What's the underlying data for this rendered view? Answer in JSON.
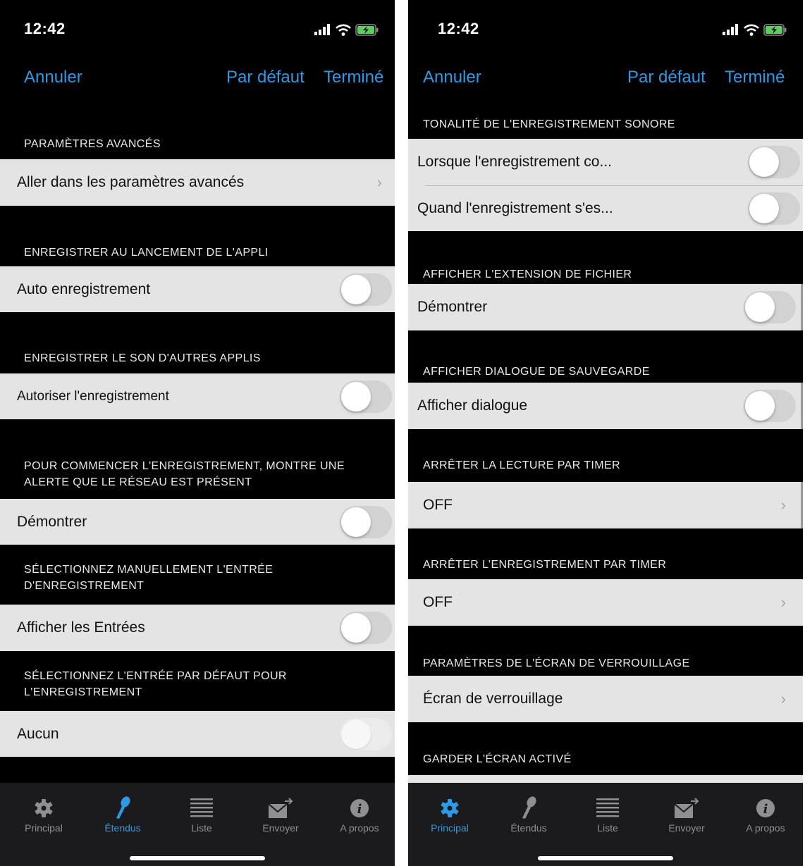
{
  "colors": {
    "accent": "#2d9ae6",
    "inactive": "#8e8e93",
    "row_bg": "#e4e4e4",
    "battery": "#5ad05a"
  },
  "left": {
    "time": "12:42",
    "nav": {
      "cancel": "Annuler",
      "default": "Par défaut",
      "done": "Terminé"
    },
    "sections": [
      {
        "header": "PARAMÈTRES AVANCÉS",
        "row": "Aller dans les paramètres avancés"
      },
      {
        "header": "ENREGISTRER AU LANCEMENT DE L'APPLI",
        "row": "Auto enregistrement",
        "toggle": false
      },
      {
        "header": "ENREGISTRER LE SON D'AUTRES APPLIS",
        "row": "Autoriser l'enregistrement",
        "toggle": false
      },
      {
        "header": "POUR COMMENCER L'ENREGISTREMENT, MONTRE UNE ALERTE QUE LE RÉSEAU EST PRÉSENT",
        "row": "Démontrer",
        "toggle": false
      },
      {
        "header": "SÉLECTIONNEZ MANUELLEMENT L'ENTRÉE D'ENREGISTREMENT",
        "row": "Afficher les Entrées",
        "toggle": false
      },
      {
        "header": "SÉLECTIONNEZ L'ENTRÉE PAR DÉFAUT POUR L'ENREGISTREMENT",
        "row": "Aucun",
        "toggle": false,
        "disabled": true
      }
    ],
    "tabs": [
      "Principal",
      "Étendus",
      "Liste",
      "Envoyer",
      "A propos"
    ],
    "active_tab": 1
  },
  "right": {
    "time": "12:42",
    "nav": {
      "cancel": "Annuler",
      "default": "Par défaut",
      "done": "Terminé"
    },
    "sections": [
      {
        "header": "TONALITÉ DE L'ENREGISTREMENT SONORE",
        "rows": [
          "Lorsque l'enregistrement co...",
          "Quand l'enregistrement s'es..."
        ],
        "toggle": false
      },
      {
        "header": "AFFICHER L'EXTENSION DE FICHIER",
        "row": "Démontrer",
        "toggle": false
      },
      {
        "header": "AFFICHER DIALOGUE DE SAUVEGARDE",
        "row": "Afficher dialogue",
        "toggle": false
      },
      {
        "header": "ARRÊTER LA LECTURE PAR TIMER",
        "row": "OFF"
      },
      {
        "header": "ARRÊTER L’ENREGISTREMENT PAR TIMER",
        "row": "OFF"
      },
      {
        "header": "PARAMÈTRES DE L'ÉCRAN DE VERROUILLAGE",
        "row": "Écran de verrouillage"
      },
      {
        "header": "GARDER L'ÉCRAN ACTIVÉ"
      }
    ],
    "tabs": [
      "Principal",
      "Étendus",
      "Liste",
      "Envoyer",
      "A propos"
    ],
    "active_tab": 0
  }
}
